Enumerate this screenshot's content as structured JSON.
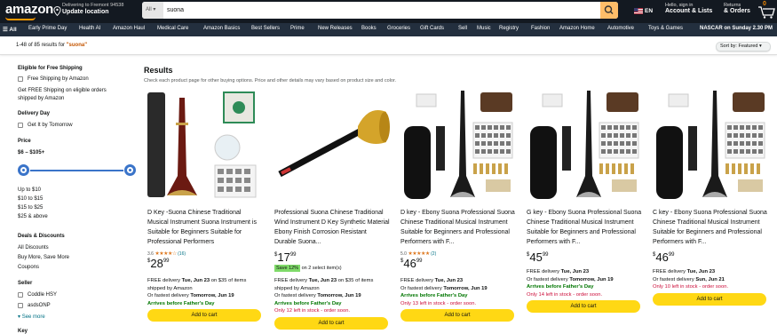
{
  "header": {
    "logo": "amazon",
    "deliver_line1": "Delivering to Fremont 94538",
    "deliver_line2": "Update location",
    "search_category": "All",
    "search_value": "suona",
    "lang": "EN",
    "account_line1": "Hello, sign in",
    "account_line2": "Account & Lists",
    "returns_line1": "Returns",
    "returns_line2": "& Orders",
    "cart_count": "0"
  },
  "nav": {
    "all_label": "All",
    "items": [
      "Early Prime Day",
      "Health AI",
      "Amazon Haul",
      "Medical Care",
      "Amazon Basics",
      "Best Sellers",
      "Prime",
      "New Releases",
      "Books",
      "Groceries",
      "Gift Cards",
      "Sell",
      "Music",
      "Registry",
      "Fashion",
      "Amazon Home",
      "Automotive",
      "Toys & Games"
    ],
    "promo": "NASCAR on Sunday 2.30 PM"
  },
  "results_bar": {
    "count_text": "1-48 of 85 results for ",
    "query": "\"suona\"",
    "sort_label": "Sort by: Featured"
  },
  "sidebar": {
    "free_shipping_heading": "Eligible for Free Shipping",
    "free_shipping_option": "Free Shipping by Amazon",
    "free_shipping_note": "Get FREE Shipping on eligible orders shipped by Amazon",
    "delivery_heading": "Delivery Day",
    "delivery_option": "Get It by Tomorrow",
    "price_heading": "Price",
    "price_range": "$6 – $105+",
    "price_slider_min_fraction": 0.0,
    "price_slider_max_fraction": 1.0,
    "price_options": [
      "Up to $10",
      "$10 to $15",
      "$15 to $25",
      "$25 & above"
    ],
    "deals_heading": "Deals & Discounts",
    "deals_options": [
      "All Discounts",
      "Buy More, Save More",
      "Coupons"
    ],
    "seller_heading": "Seller",
    "seller_options": [
      "Coddle HSY",
      "asdsONP"
    ],
    "see_more": "See more",
    "key_heading": "Key"
  },
  "main": {
    "heading": "Results",
    "subheading": "Check each product page for other buying options. Price and other details may vary based on product size and color."
  },
  "products": [
    {
      "title": "D Key -Suona Chinese Traditional Musical Instrument Suona Instrument is Suitable for Beginners Suitable for Professional Performers",
      "rating_value": "3.6",
      "rating_stars": 3.5,
      "rating_count": "(16)",
      "price_whole": "28",
      "price_frac": "99",
      "save_tag": "",
      "save_text": "",
      "lines": [
        {
          "parts": [
            [
              "FREE delivery ",
              ""
            ],
            [
              "Tue, Jun 23",
              "b"
            ],
            [
              " on $35 of items",
              ""
            ]
          ]
        },
        {
          "parts": [
            [
              "shipped by Amazon",
              ""
            ]
          ]
        },
        {
          "parts": [
            [
              "Or fastest delivery ",
              ""
            ],
            [
              "Tomorrow, Jun 19",
              "b"
            ]
          ]
        },
        {
          "parts": [
            [
              "Arrives before Father's Day",
              "green"
            ]
          ]
        }
      ],
      "cart_label": "Add to cart"
    },
    {
      "title": "Professional Suona Chinese Traditional Wind Instrument D Key Synthetic Material Ebony Finish Corrosion Resistant Durable Suona...",
      "rating_value": "",
      "rating_stars": 0,
      "rating_count": "",
      "price_whole": "17",
      "price_frac": "99",
      "save_tag": "Save 12%",
      "save_text": " on 2 select item(s)",
      "lines": [
        {
          "parts": [
            [
              "FREE delivery ",
              ""
            ],
            [
              "Tue, Jun 23",
              "b"
            ],
            [
              " on $35 of items",
              ""
            ]
          ]
        },
        {
          "parts": [
            [
              "shipped by Amazon",
              ""
            ]
          ]
        },
        {
          "parts": [
            [
              "Or fastest delivery ",
              ""
            ],
            [
              "Tomorrow, Jun 19",
              "b"
            ]
          ]
        },
        {
          "parts": [
            [
              "Arrives before Father's Day",
              "green"
            ]
          ]
        },
        {
          "parts": [
            [
              "Only 12 left in stock - order soon.",
              "red"
            ]
          ]
        }
      ],
      "cart_label": "Add to cart"
    },
    {
      "title": "D key - Ebony Suona Professional Suona Chinese Traditional Musical Instrument Suitable for Beginners and Professional Performers with F...",
      "rating_value": "5.0",
      "rating_stars": 5,
      "rating_count": "(2)",
      "price_whole": "46",
      "price_frac": "99",
      "save_tag": "",
      "save_text": "",
      "lines": [
        {
          "parts": [
            [
              "FREE delivery ",
              ""
            ],
            [
              "Tue, Jun 23",
              "b"
            ]
          ]
        },
        {
          "parts": [
            [
              "Or fastest delivery ",
              ""
            ],
            [
              "Tomorrow, Jun 19",
              "b"
            ]
          ]
        },
        {
          "parts": [
            [
              "Arrives before Father's Day",
              "green"
            ]
          ]
        },
        {
          "parts": [
            [
              "Only 13 left in stock - order soon.",
              "red"
            ]
          ]
        }
      ],
      "cart_label": "Add to cart"
    },
    {
      "title": "G key - Ebony Suona Professional Suona Chinese Traditional Musical Instrument Suitable for Beginners and Professional Performers with F...",
      "rating_value": "",
      "rating_stars": 0,
      "rating_count": "",
      "price_whole": "45",
      "price_frac": "99",
      "save_tag": "",
      "save_text": "",
      "lines": [
        {
          "parts": [
            [
              "FREE delivery ",
              ""
            ],
            [
              "Tue, Jun 23",
              "b"
            ]
          ]
        },
        {
          "parts": [
            [
              "Or fastest delivery ",
              ""
            ],
            [
              "Tomorrow, Jun 19",
              "b"
            ]
          ]
        },
        {
          "parts": [
            [
              "Arrives before Father's Day",
              "green"
            ]
          ]
        },
        {
          "parts": [
            [
              "Only 14 left in stock - order soon.",
              "red"
            ]
          ]
        }
      ],
      "cart_label": "Add to cart"
    },
    {
      "title": "C key - Ebony Suona Professional Suona Chinese Traditional Musical Instrument Suitable for Beginners and Professional Performers with F...",
      "rating_value": "",
      "rating_stars": 0,
      "rating_count": "",
      "price_whole": "46",
      "price_frac": "99",
      "save_tag": "",
      "save_text": "",
      "lines": [
        {
          "parts": [
            [
              "FREE delivery ",
              ""
            ],
            [
              "Tue, Jun 23",
              "b"
            ]
          ]
        },
        {
          "parts": [
            [
              "Or fastest delivery ",
              ""
            ],
            [
              "Sun, Jun 21",
              "b"
            ]
          ]
        },
        {
          "parts": [
            [
              "Only 10 left in stock - order soon.",
              "red"
            ]
          ]
        }
      ],
      "cart_label": "Add to cart"
    }
  ],
  "colors": {
    "header_bg": "#131921",
    "nav_bg": "#232f3e",
    "search_button": "#febd69",
    "cart_button": "#ffd814",
    "accent_orange": "#ff9900",
    "link_teal": "#007185",
    "green": "#007600",
    "red": "#cc0c39"
  }
}
